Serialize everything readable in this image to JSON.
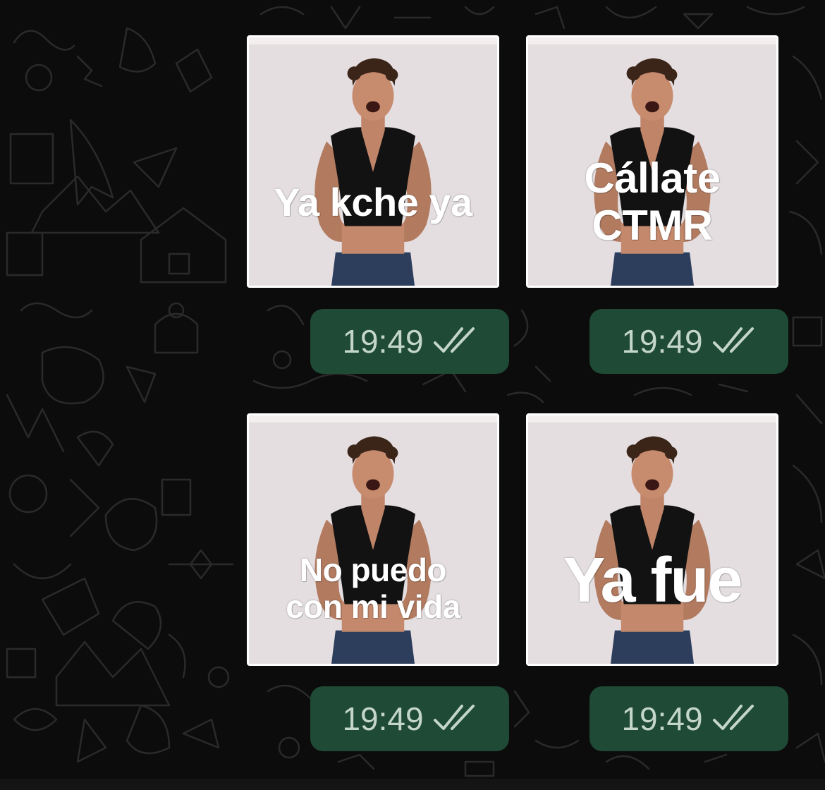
{
  "colors": {
    "background": "#0c0c0c",
    "bubble": "#1f4a35",
    "time_text": "#c4d6ca",
    "sticker_border": "#ffffff"
  },
  "messages": [
    {
      "caption": "Ya kche ya",
      "time": "19:49",
      "status_icon": "double-check-icon"
    },
    {
      "caption": "Cállate\nCTMR",
      "time": "19:49",
      "status_icon": "double-check-icon"
    },
    {
      "caption": "No puedo\ncon mi vida",
      "time": "19:49",
      "status_icon": "double-check-icon"
    },
    {
      "caption": "Ya fue",
      "time": "19:49",
      "status_icon": "double-check-icon"
    }
  ]
}
